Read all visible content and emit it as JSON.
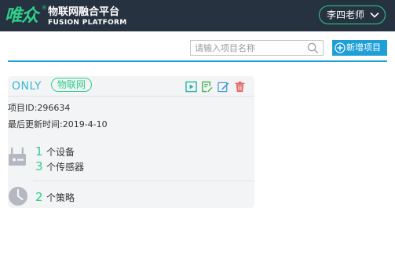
{
  "header": {
    "logo_text": "唯众",
    "logo_reg": "®",
    "brand_cn": "物联网融合平台",
    "brand_en": "FUSION PLATFORM",
    "user_name": "李四老师"
  },
  "toolbar": {
    "search_placeholder": "请输入项目名称",
    "add_label": "新增项目"
  },
  "card": {
    "title": "ONLY",
    "tag": "物联网",
    "project_id": "项目ID:296634",
    "updated": "最后更新时间:2019-4-10",
    "device_count": "1",
    "device_unit": "个设备",
    "sensor_count": "3",
    "sensor_unit": "个传感器",
    "policy_count": "2",
    "policy_unit": "个策略"
  },
  "colors": {
    "topbar": "#26323f",
    "accent_green": "#2fcf8a",
    "accent_blue": "#1e9fd8",
    "title_teal": "#3db8d0",
    "delete_red": "#e46a6a",
    "card_bg": "#f3f4f6"
  },
  "icons": [
    "chevron-down-icon",
    "search-icon",
    "plus-circle-icon",
    "play-icon",
    "report-icon",
    "edit-icon",
    "delete-icon",
    "router-icon",
    "clock-icon"
  ]
}
